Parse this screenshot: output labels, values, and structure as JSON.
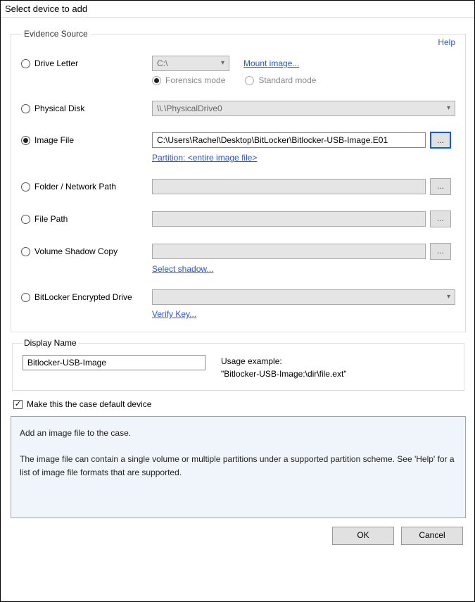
{
  "title": "Select device to add",
  "group_label": "Evidence Source",
  "help": "Help",
  "drive_letter": {
    "label": "Drive Letter",
    "value": "C:\\",
    "mount_link": "Mount image...",
    "forensics_label": "Forensics mode",
    "standard_label": "Standard mode"
  },
  "physical_disk": {
    "label": "Physical Disk",
    "value": "\\\\.\\PhysicalDrive0"
  },
  "image_file": {
    "label": "Image File",
    "value": "C:\\Users\\Rachel\\Desktop\\BitLocker\\Bitlocker-USB-Image.E01",
    "partition_link": "Partition: <entire image file>",
    "browse": "..."
  },
  "folder_path": {
    "label": "Folder / Network Path",
    "browse": "..."
  },
  "file_path": {
    "label": "File Path",
    "browse": "..."
  },
  "vsc": {
    "label": "Volume Shadow Copy",
    "select_link": "Select shadow...",
    "browse": "..."
  },
  "bitlocker": {
    "label": "BitLocker Encrypted Drive",
    "verify_link": "Verify Key..."
  },
  "display_name": {
    "legend": "Display Name",
    "value": "Bitlocker-USB-Image",
    "usage_title": "Usage example:",
    "usage_value": "\"Bitlocker-USB-Image:\\dir\\file.ext\""
  },
  "default_checkbox": {
    "label": "Make this the case default device",
    "checked": "✓"
  },
  "info": {
    "line1": "Add an image file to the case.",
    "line2": "The image file can contain a single volume or multiple partitions under a supported partition scheme. See 'Help' for a list of image file formats that are supported."
  },
  "buttons": {
    "ok": "OK",
    "cancel": "Cancel"
  }
}
